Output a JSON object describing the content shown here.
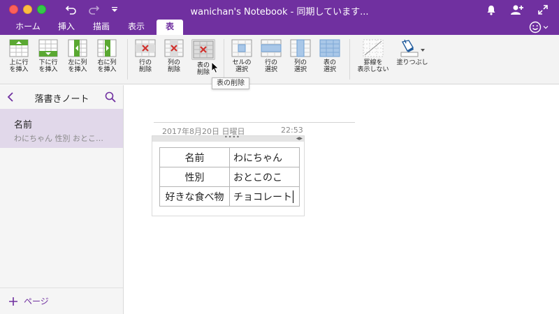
{
  "titlebar": {
    "title": "wanichan's Notebook - 同期しています..."
  },
  "tabs": [
    {
      "label": "ホーム"
    },
    {
      "label": "挿入"
    },
    {
      "label": "描画"
    },
    {
      "label": "表示"
    },
    {
      "label": "表",
      "active": true
    }
  ],
  "ribbon": {
    "insert_row_above": "上に行\nを挿入",
    "insert_row_below": "下に行\nを挿入",
    "insert_col_left": "左に列\nを挿入",
    "insert_col_right": "右に列\nを挿入",
    "delete_row": "行の\n削除",
    "delete_col": "列の\n削除",
    "delete_table": "表の\n削除",
    "select_cell": "セルの\n選択",
    "select_row": "行の\n選択",
    "select_col": "列の\n選択",
    "select_table": "表の\n選択",
    "hide_borders": "罫線を\n表示しない",
    "shading": "塗りつぶし"
  },
  "tooltip": "表の削除",
  "sidebar": {
    "section_name": "落書きノート",
    "page_title": "名前",
    "page_preview": "わにちゃん  性別  おとこ…",
    "add_page": "ページ"
  },
  "note": {
    "date": "2017年8月20日 日曜日",
    "time": "22:53",
    "table": [
      [
        "名前",
        "わにちゃん"
      ],
      [
        "性別",
        "おとこのこ"
      ],
      [
        "好きな食べ物",
        "チョコレート"
      ]
    ]
  },
  "colors": {
    "accent": "#7030A0",
    "selected_page": "#e1d8ea",
    "delete_red": "#d0312d",
    "insert_green": "#5aa832"
  },
  "icons": [
    "undo-icon",
    "redo-icon",
    "dropdown-icon",
    "bell-icon",
    "add-person-icon",
    "fullscreen-icon",
    "smiley-icon",
    "back-chevron-icon",
    "search-icon",
    "plus-icon",
    "paint-bucket-icon"
  ]
}
